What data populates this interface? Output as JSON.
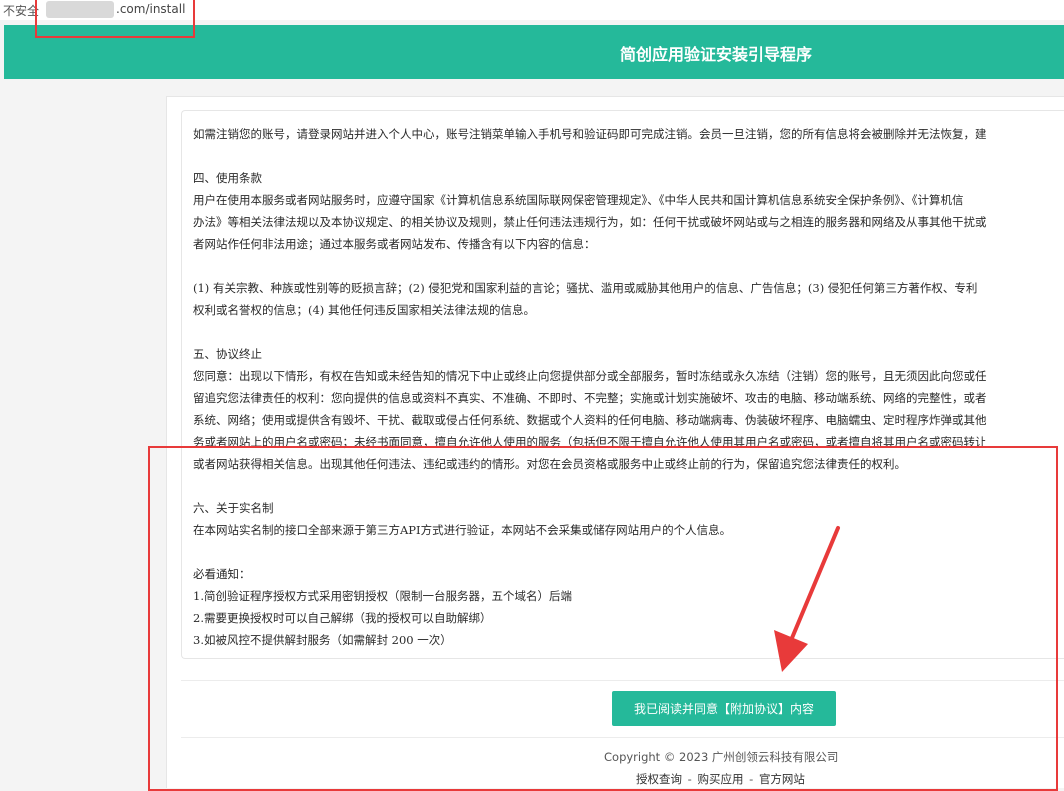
{
  "browser": {
    "insecure_label": "不安全",
    "url_text": ".com/install"
  },
  "header": {
    "title": "简创应用验证安装引导程序"
  },
  "terms": {
    "lines": [
      "如需注销您的账号，请登录网站并进入个人中心，账号注销菜单输入手机号和验证码即可完成注销。会员一旦注销，您的所有信息将会被删除并无法恢复，建",
      "",
      "四、使用条款",
      "用户在使用本服务或者网站服务时，应遵守国家《计算机信息系统国际联网保密管理规定》、《中华人民共和国计算机信息系统安全保护条例》、《计算机信",
      "办法》等相关法律法规以及本协议规定、的相关协议及规则，禁止任何违法违规行为，如：任何干扰或破坏网站或与之相连的服务器和网络及从事其他干扰或",
      "者网站作任何非法用途；通过本服务或者网站发布、传播含有以下内容的信息：",
      "",
      "(1) 有关宗教、种族或性别等的贬损言辞；(2) 侵犯党和国家利益的言论；骚扰、滥用或威胁其他用户的信息、广告信息；(3) 侵犯任何第三方著作权、专利",
      "权利或名誉权的信息；(4) 其他任何违反国家相关法律法规的信息。",
      "",
      "五、协议终止",
      "您同意：出现以下情形，有权在告知或未经告知的情况下中止或终止向您提供部分或全部服务，暂时冻结或永久冻结（注销）您的账号，且无须因此向您或任",
      "留追究您法律责任的权利：您向提供的信息或资料不真实、不准确、不即时、不完整；实施或计划实施破坏、攻击的电脑、移动端系统、网络的完整性，或者",
      "系统、网络；使用或提供含有毁坏、干扰、截取或侵占任何系统、数据或个人资料的任何电脑、移动端病毒、伪装破坏程序、电脑蠕虫、定时程序炸弹或其他",
      "务或者网站上的用户名或密码；未经书面同意，擅自允许他人使用的服务（包括但不限于擅自允许他人使用其用户名或密码，或者擅自将其用户名或密码转让",
      "或者网站获得相关信息。出现其他任何违法、违纪或违约的情形。对您在会员资格或服务中止或终止前的行为，保留追究您法律责任的权利。",
      "",
      "六、关于实名制",
      "在本网站实名制的接口全部来源于第三方API方式进行验证，本网站不会采集或储存网站用户的个人信息。",
      "",
      "必看通知：",
      "1.简创验证程序授权方式采用密钥授权（限制一台服务器，五个域名）后端",
      "2.需要更换授权时可以自己解绑（我的授权可以自助解绑）",
      "3.如被风控不提供解封服务（如需解封 200 一次）"
    ]
  },
  "actions": {
    "agree_label": "我已阅读并同意【附加协议】内容"
  },
  "footer": {
    "copyright": "Copyright © 2023 广州创领云科技有限公司",
    "links": [
      "授权查询",
      "购买应用",
      "官方网站"
    ],
    "separator": "-"
  },
  "colors": {
    "accent": "#25b99a",
    "annotation": "#e83a3a"
  }
}
